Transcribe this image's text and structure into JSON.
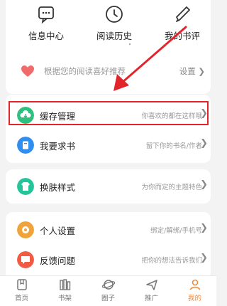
{
  "quick_actions": [
    {
      "label": "信息中心",
      "icon": "message-icon"
    },
    {
      "label": "阅读历史",
      "icon": "clock-icon"
    },
    {
      "label": "我的书评",
      "icon": "pen-icon"
    }
  ],
  "recommend": {
    "text": "根据您的阅读喜好推荐",
    "action": "设置"
  },
  "menu": [
    {
      "title": "缓存管理",
      "subtitle": "你喜欢的都在这样哦",
      "icon": "cloud-download-icon",
      "color": "#2fbf7f"
    },
    {
      "title": "我要求书",
      "subtitle": "留下你的书名/作者",
      "icon": "book-request-icon",
      "color": "#2f8ef0"
    },
    {
      "title": "换肤样式",
      "subtitle": "为你而定的主题特色",
      "icon": "skin-icon",
      "color": "#25c49a"
    },
    {
      "title": "个人设置",
      "subtitle": "绑定/解绑/手机号",
      "icon": "settings-icon",
      "color": "#f0a33a"
    },
    {
      "title": "反馈问题",
      "subtitle": "把你的想法告诉我们",
      "icon": "feedback-icon",
      "color": "#f25b43"
    }
  ],
  "tabs": [
    {
      "label": "首页",
      "icon": "home-icon"
    },
    {
      "label": "书架",
      "icon": "bookshelf-icon"
    },
    {
      "label": "圈子",
      "icon": "planet-icon"
    },
    {
      "label": "推广",
      "icon": "send-icon"
    },
    {
      "label": "我的",
      "icon": "profile-icon",
      "active": true
    }
  ],
  "colors": {
    "accent": "#e2242b",
    "active_tab": "#f08a3a"
  }
}
